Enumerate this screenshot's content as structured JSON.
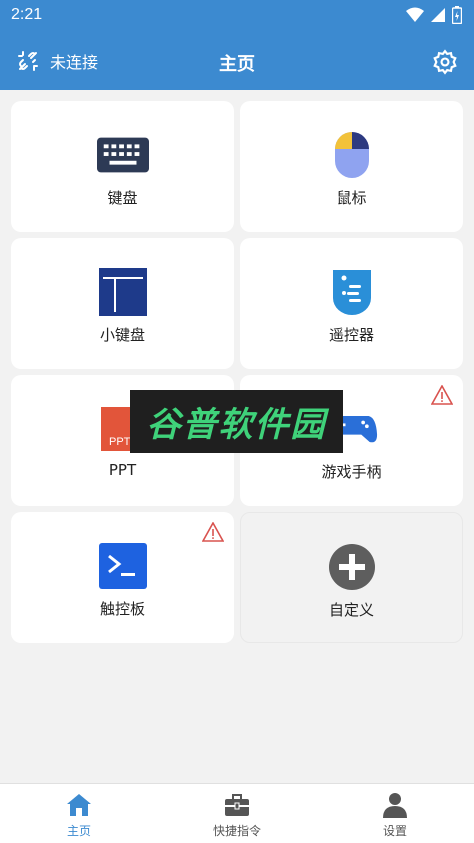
{
  "status": {
    "time": "2:21"
  },
  "header": {
    "title": "主页",
    "connection": "未连接"
  },
  "cards": [
    {
      "label": "键盘",
      "icon": "keyboard-icon",
      "warning": false
    },
    {
      "label": "鼠标",
      "icon": "mouse-icon",
      "warning": false
    },
    {
      "label": "小键盘",
      "icon": "numpad-icon",
      "warning": false
    },
    {
      "label": "遥控器",
      "icon": "remote-icon",
      "warning": false
    },
    {
      "label": "PPT",
      "icon": "ppt-icon",
      "icon_text": "PPT",
      "warning": false
    },
    {
      "label": "游戏手柄",
      "icon": "gamepad-icon",
      "warning": true
    },
    {
      "label": "触控板",
      "icon": "terminal-icon",
      "warning": true
    },
    {
      "label": "自定义",
      "icon": "add-icon",
      "warning": false
    }
  ],
  "watermark": {
    "text": "谷普软件园"
  },
  "nav": [
    {
      "label": "主页",
      "icon": "home-icon",
      "active": true
    },
    {
      "label": "快捷指令",
      "icon": "toolbox-icon",
      "active": false
    },
    {
      "label": "设置",
      "icon": "user-icon",
      "active": false
    }
  ],
  "colors": {
    "primary": "#3c8ad0",
    "background": "#f2f2f2",
    "warning": "#d9534f"
  }
}
